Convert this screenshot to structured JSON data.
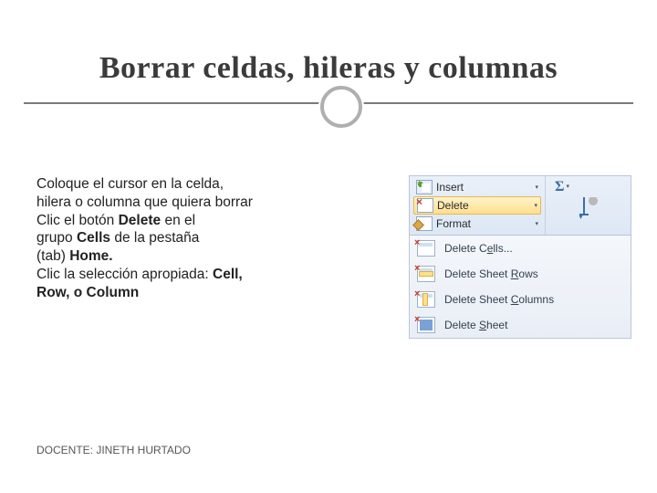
{
  "title": "Borrar celdas, hileras y columnas",
  "body": {
    "p1a": "Coloque el cursor en la celda,",
    "p1b": "hilera o columna que quiera borrar",
    "p2a": "Clic el botón ",
    "p2b_bold": "Delete",
    "p2c": " en el",
    "p3a": "grupo ",
    "p3b_bold": "Cells",
    "p3c": " de la pestaña",
    "p4a": "(tab) ",
    "p4b_bold": "Home.",
    "p5a": "Clic la selección apropiada:  ",
    "p5b_bold": "Cell,",
    "p6_bold": "Row, o Column"
  },
  "ribbon": {
    "insert": "Insert",
    "delete": "Delete",
    "format": "Format",
    "sigma": "Σ"
  },
  "menu": {
    "cells_pre": "Delete C",
    "cells_u": "e",
    "cells_post": "lls...",
    "rows_pre": "Delete Sheet ",
    "rows_u": "R",
    "rows_post": "ows",
    "cols_pre": "Delete Sheet ",
    "cols_u": "C",
    "cols_post": "olumns",
    "sheet_pre": "Delete ",
    "sheet_u": "S",
    "sheet_post": "heet"
  },
  "footer": "DOCENTE: JINETH HURTADO"
}
